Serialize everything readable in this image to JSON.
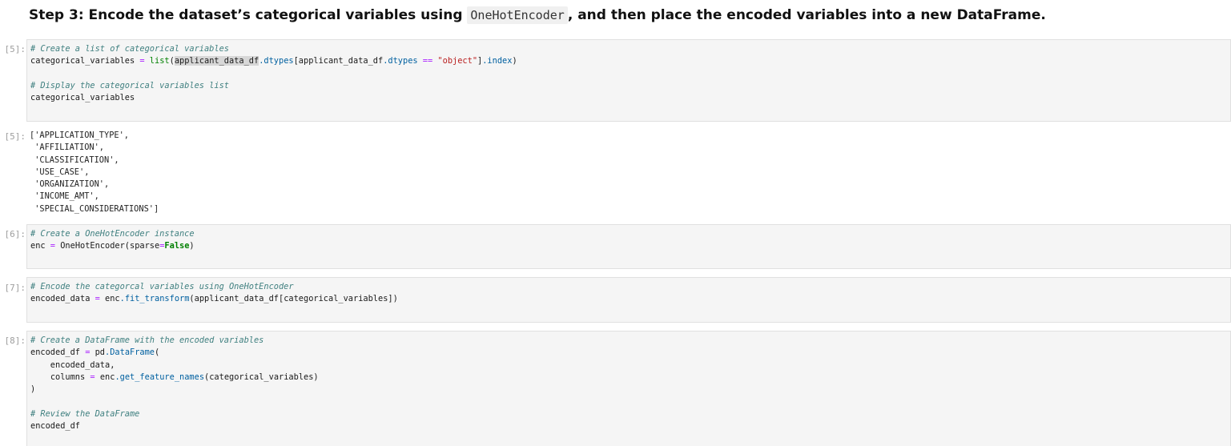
{
  "heading": {
    "prefix": "Step 3: Encode the dataset’s categorical variables using ",
    "code": "OneHotEncoder",
    "suffix": ", and then place the encoded variables into a new DataFrame."
  },
  "cells": [
    {
      "prompt": "[5]:",
      "lines": [
        {
          "comment": "# Create a list of categorical variables"
        },
        {
          "var": "categorical_variables",
          "op": " = ",
          "fn": "list",
          "open": "(",
          "arg_hl": "applicant_data_df",
          "attr": ".dtypes",
          "idx_open": "[applicant_data_df",
          "attr2": ".dtypes",
          "cmp": " == ",
          "str": "\"object\"",
          "close": "]",
          "attr3": ".index",
          "end": ")"
        },
        {
          "blank": ""
        },
        {
          "comment": "# Display the categorical variables list"
        },
        {
          "plain": "categorical_variables"
        }
      ]
    },
    {
      "prompt": "[6]:",
      "lines": [
        {
          "comment": "# Create a OneHotEncoder instance"
        },
        {
          "var": "enc",
          "op": " = ",
          "call": "OneHotEncoder(sparse",
          "eq": "=",
          "kw": "False",
          "end": ")"
        }
      ]
    },
    {
      "prompt": "[7]:",
      "lines": [
        {
          "comment": "# Encode the categorcal variables using OneHotEncoder"
        },
        {
          "var": "encoded_data",
          "op": " = ",
          "obj": "enc",
          "method": ".fit_transform",
          "rest": "(applicant_data_df[categorical_variables])"
        }
      ]
    },
    {
      "prompt": "[8]:",
      "lines": [
        {
          "comment": "# Create a DataFrame with the encoded variables"
        },
        {
          "var": "encoded_df",
          "op": " = ",
          "obj": "pd",
          "method": ".DataFrame",
          "rest": "("
        },
        {
          "plain": "    encoded_data,"
        },
        {
          "indent": "    ",
          "var": "columns",
          "op": " = ",
          "obj": "enc",
          "method": ".get_feature_names",
          "rest": "(categorical_variables)"
        },
        {
          "plain": ")"
        },
        {
          "blank": ""
        },
        {
          "comment": "# Review the DataFrame"
        },
        {
          "plain": "encoded_df"
        }
      ]
    }
  ],
  "output_5": {
    "prompt": "[5]:",
    "lines": [
      "['APPLICATION_TYPE',",
      " 'AFFILIATION',",
      " 'CLASSIFICATION',",
      " 'USE_CASE',",
      " 'ORGANIZATION',",
      " 'INCOME_AMT',",
      " 'SPECIAL_CONSIDERATIONS']"
    ]
  }
}
